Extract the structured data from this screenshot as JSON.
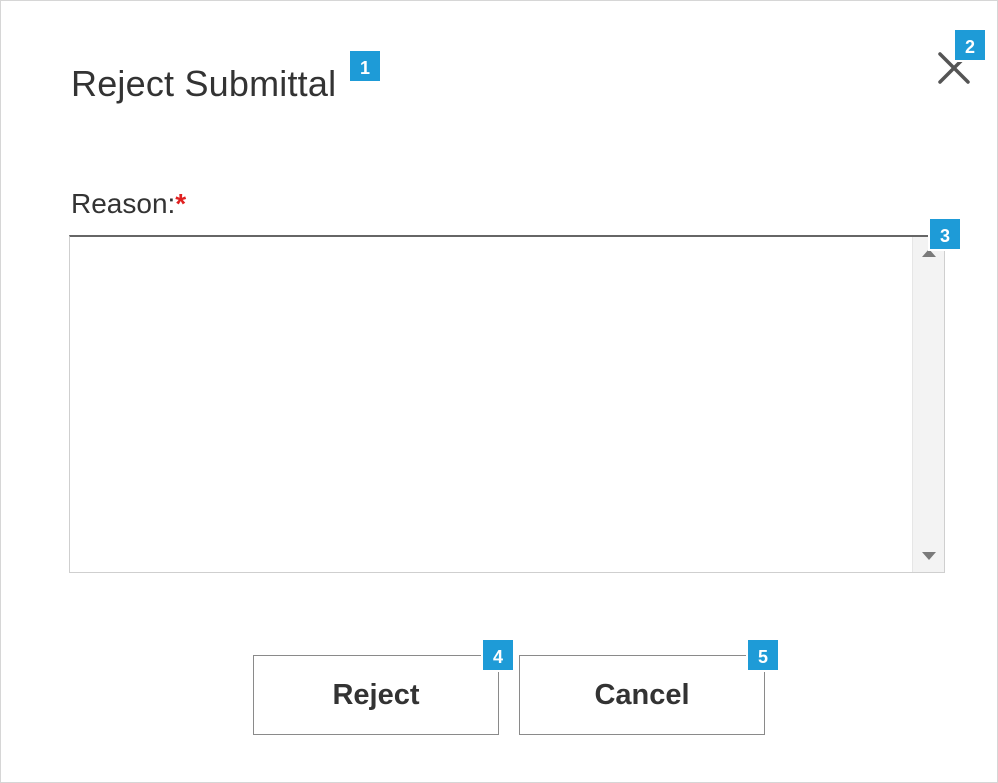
{
  "dialog": {
    "title": "Reject Submittal",
    "close_icon": "close-icon"
  },
  "form": {
    "reason_label": "Reason:",
    "required_marker": "*",
    "reason_value": "",
    "reason_placeholder": ""
  },
  "actions": {
    "reject_label": "Reject",
    "cancel_label": "Cancel"
  },
  "badges": {
    "b1": "1",
    "b2": "2",
    "b3": "3",
    "b4": "4",
    "b5": "5"
  },
  "colors": {
    "badge": "#1e9bd7",
    "required": "#e02020",
    "text": "#333333"
  }
}
